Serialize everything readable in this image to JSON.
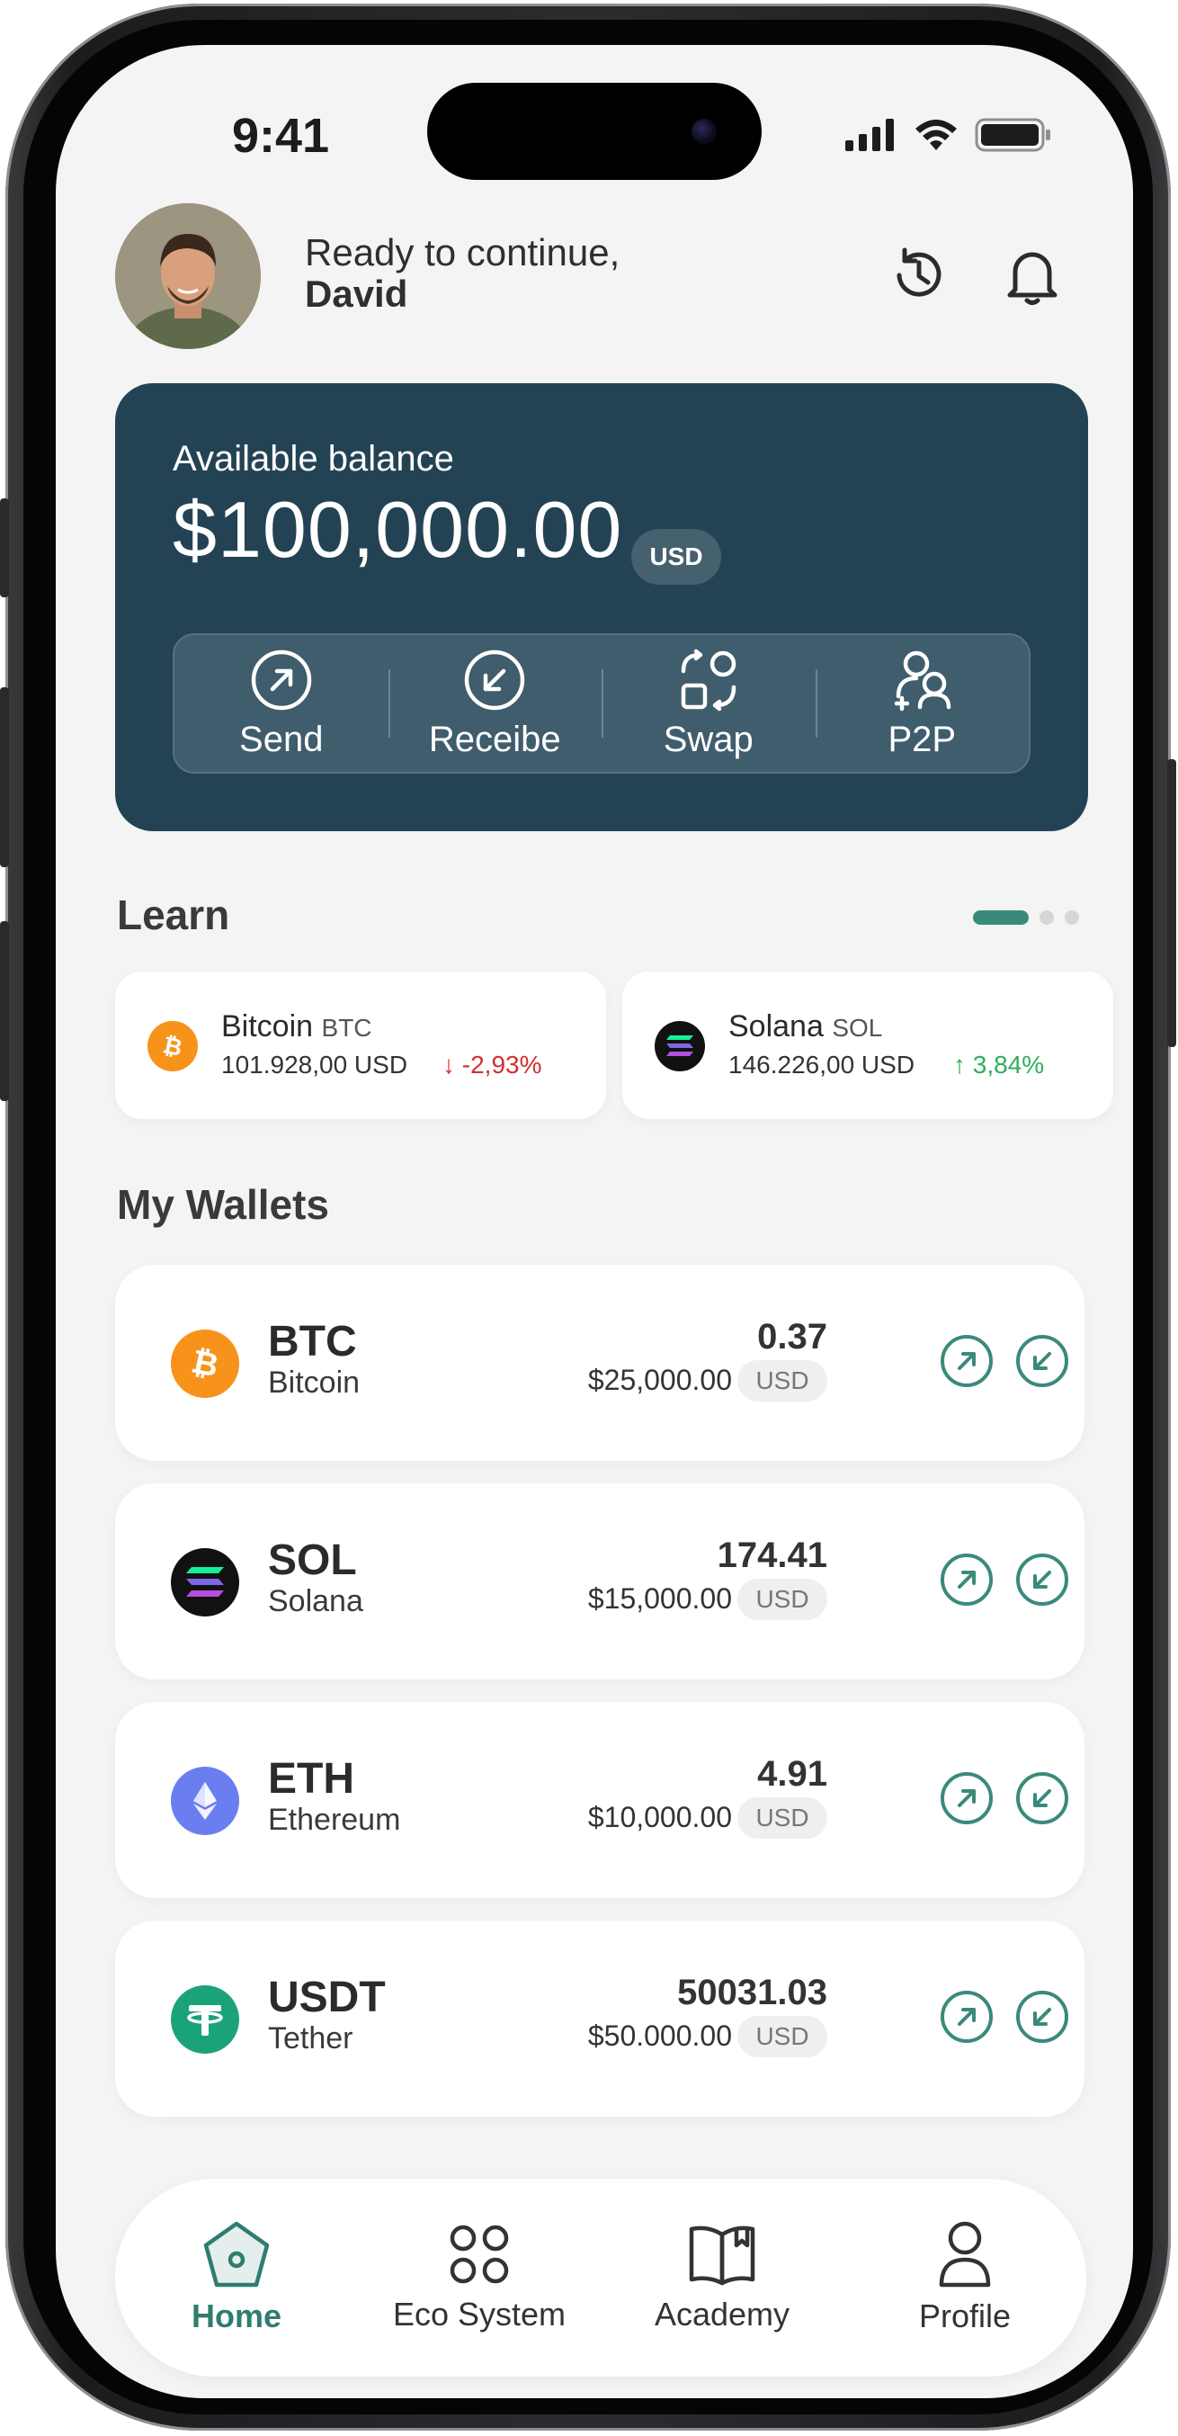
{
  "status_bar": {
    "time": "9:41"
  },
  "header": {
    "greeting": "Ready to continue,",
    "user_name": "David",
    "icons": [
      "history-icon",
      "bell-icon"
    ]
  },
  "balance_card": {
    "label": "Available balance",
    "amount": "$100,000.00",
    "currency": "USD",
    "actions": [
      {
        "label": "Send",
        "icon": "send-arrow-icon"
      },
      {
        "label": "Receibe",
        "icon": "receive-arrow-icon"
      },
      {
        "label": "Swap",
        "icon": "swap-icon"
      },
      {
        "label": "P2P",
        "icon": "p2p-users-icon"
      }
    ],
    "colors": {
      "card_bg": "#234354",
      "actions_bg": "#3f5d6c"
    }
  },
  "learn": {
    "title": "Learn",
    "cards": [
      {
        "name": "Bitcoin",
        "ticker": "BTC",
        "price": "101.928,00 USD",
        "change": "-2,93%",
        "direction": "down",
        "icon": "bitcoin-icon"
      },
      {
        "name": "Solana",
        "ticker": "SOL",
        "price": "146.226,00 USD",
        "change": "3,84%",
        "direction": "up",
        "icon": "solana-icon"
      }
    ],
    "colors": {
      "down": "#d32f2f",
      "up": "#2eae5a"
    }
  },
  "wallets": {
    "title": "My Wallets",
    "items": [
      {
        "symbol": "BTC",
        "name": "Bitcoin",
        "amount": "0.37",
        "value": "$25,000.00",
        "currency": "USD",
        "icon": "bitcoin-icon"
      },
      {
        "symbol": "SOL",
        "name": "Solana",
        "amount": "174.41",
        "value": "$15,000.00",
        "currency": "USD",
        "icon": "solana-icon"
      },
      {
        "symbol": "ETH",
        "name": "Ethereum",
        "amount": "4.91",
        "value": "$10,000.00",
        "currency": "USD",
        "icon": "ethereum-icon"
      },
      {
        "symbol": "USDT",
        "name": "Tether",
        "amount": "50031.03",
        "value": "$50.000.00",
        "currency": "USD",
        "icon": "tether-icon"
      }
    ]
  },
  "tabbar": {
    "items": [
      {
        "label": "Home",
        "icon": "home-icon",
        "active": true
      },
      {
        "label": "Eco System",
        "icon": "grid-icon",
        "active": false
      },
      {
        "label": "Academy",
        "icon": "book-icon",
        "active": false
      },
      {
        "label": "Profile",
        "icon": "profile-icon",
        "active": false
      }
    ],
    "colors": {
      "active": "#2f7d70"
    }
  }
}
